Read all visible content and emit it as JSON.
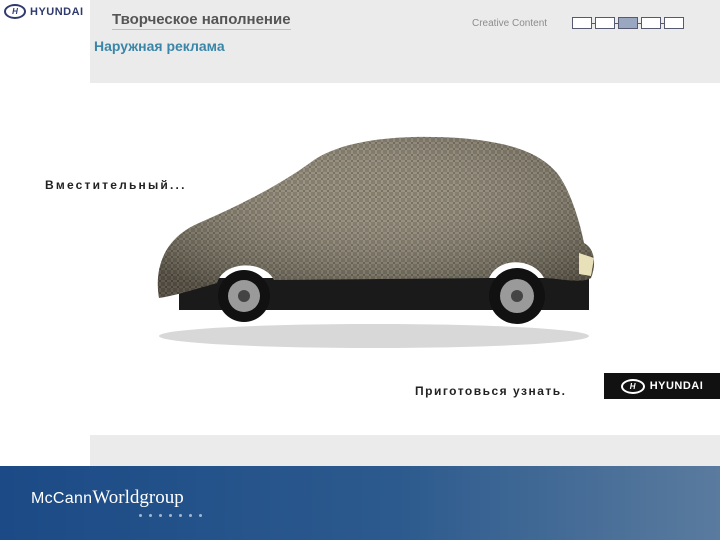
{
  "header": {
    "logo_icon": "hyundai-logo-icon",
    "logo_text": "HYUNDAI",
    "title": "Творческое наполнение",
    "subtitle": "Наружная реклама",
    "section_label": "Creative Content",
    "progress": {
      "steps": 5,
      "active_step": 3
    }
  },
  "ad": {
    "headline": "Вместительный...",
    "tagline": "Приготовься узнать.",
    "logo_text": "HYUNDAI",
    "image_subject": "covered-car"
  },
  "footer": {
    "brand_mc": "McCann",
    "brand_wg": "Worldgroup"
  },
  "colors": {
    "subtitle": "#3a86a8",
    "footer_start": "#1b4a86",
    "footer_end": "#5a7b9e",
    "brand": "#2f3a6e"
  }
}
